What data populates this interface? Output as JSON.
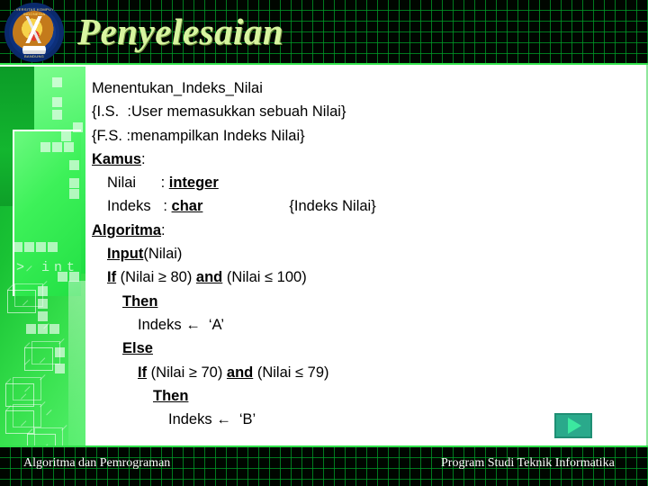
{
  "header": {
    "title": "Penyelesaian",
    "logo": {
      "name": "unikom-logo",
      "text_top": "UNIVERSITAS KOMPUTER INDONESIA",
      "text_bottom": "BANDUNG"
    }
  },
  "sidebar": {
    "code_motif": "> int"
  },
  "content": {
    "lines": [
      {
        "indent": 0,
        "parts": [
          {
            "t": "Menentukan_Indeks_Nilai",
            "style": "plain"
          }
        ]
      },
      {
        "indent": 0,
        "parts": [
          {
            "t": "{I.S.  :User memasukkan sebuah Nilai}",
            "style": "plain"
          }
        ]
      },
      {
        "indent": 0,
        "parts": [
          {
            "t": "{F.S. :menampilkan Indeks Nilai}",
            "style": "plain"
          }
        ]
      },
      {
        "indent": 0,
        "parts": [
          {
            "t": "Kamus",
            "style": "kw"
          },
          {
            "t": ":",
            "style": "plain"
          }
        ]
      },
      {
        "indent": 1,
        "parts": [
          {
            "t": "Nilai      : ",
            "style": "plain"
          },
          {
            "t": "integer",
            "style": "kw"
          }
        ]
      },
      {
        "indent": 1,
        "parts": [
          {
            "t": "Indeks   : ",
            "style": "plain"
          },
          {
            "t": "char",
            "style": "kw"
          },
          {
            "t": "{Indeks Nilai}",
            "style": "tail"
          }
        ]
      },
      {
        "indent": 0,
        "parts": [
          {
            "t": "Algoritma",
            "style": "kw"
          },
          {
            "t": ":",
            "style": "plain"
          }
        ]
      },
      {
        "indent": 1,
        "parts": [
          {
            "t": "Input",
            "style": "kw"
          },
          {
            "t": "(Nilai)",
            "style": "plain"
          }
        ]
      },
      {
        "indent": 1,
        "parts": [
          {
            "t": "If",
            "style": "kw"
          },
          {
            "t": " (Nilai ≥ 80) ",
            "style": "plain"
          },
          {
            "t": "and",
            "style": "kw"
          },
          {
            "t": " (Nilai ≤ 100)",
            "style": "plain"
          }
        ]
      },
      {
        "indent": 2,
        "parts": [
          {
            "t": "Then",
            "style": "kw"
          }
        ]
      },
      {
        "indent": 3,
        "parts": [
          {
            "t": "Indeks ←  ‘A’",
            "style": "plain"
          }
        ]
      },
      {
        "indent": 2,
        "parts": [
          {
            "t": "Else",
            "style": "kw"
          }
        ]
      },
      {
        "indent": 3,
        "parts": [
          {
            "t": "If",
            "style": "kw"
          },
          {
            "t": " (Nilai ≥ 70) ",
            "style": "plain"
          },
          {
            "t": "and",
            "style": "kw"
          },
          {
            "t": " (Nilai ≤ 79)",
            "style": "plain"
          }
        ]
      },
      {
        "indent": 4,
        "parts": [
          {
            "t": "Then",
            "style": "kw"
          }
        ]
      },
      {
        "indent": 5,
        "parts": [
          {
            "t": "Indeks ←  ‘B’",
            "style": "plain"
          }
        ]
      }
    ]
  },
  "nav": {
    "next_label": "▶",
    "next_name": "next-slide-button"
  },
  "footer": {
    "left": "Algoritma dan Pemrograman",
    "right": "Program Studi Teknik Informatika"
  },
  "colors": {
    "accent_green": "#2fe04a",
    "title_green": "#d8f5a0",
    "sidebar_green": "#19c234",
    "grid_line": "#00a028",
    "button_teal": "#2aa98b",
    "button_arrow": "#3ce8a0",
    "text_black": "#000000",
    "page_white": "#ffffff"
  }
}
